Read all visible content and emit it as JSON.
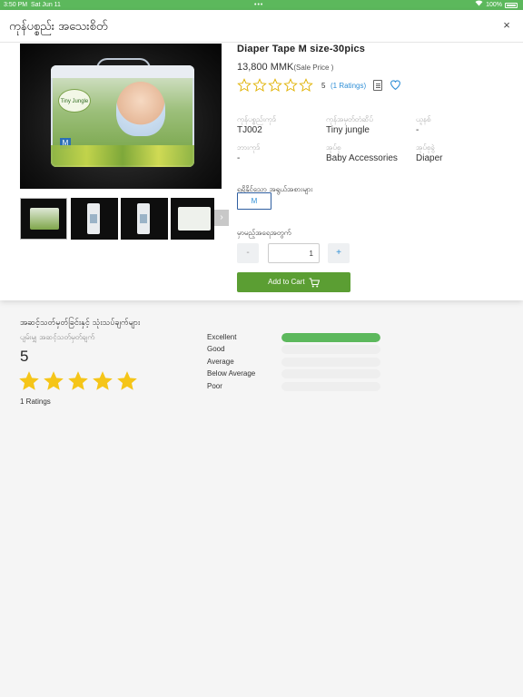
{
  "status_bar": {
    "time": "3:50 PM",
    "date": "Sat Jun 11",
    "battery": "100%"
  },
  "modal": {
    "title": "ကုန်ပစ္စည်း အသေးစိတ်",
    "close": "×"
  },
  "product": {
    "name": "Diaper Tape M size-30pics",
    "price": "13,800 MMK",
    "price_note": "(Sale Price )",
    "rating_value": "5",
    "rating_link": "(1 Ratings)",
    "thumbnail_next": "›"
  },
  "meta": [
    {
      "label": "ကုန်ပစ္စည်းကုဒ်",
      "value": "TJ002"
    },
    {
      "label": "ကုန်အမှတ်တံဆိပ်",
      "value": "Tiny jungle"
    },
    {
      "label": "ယူနစ်",
      "value": "-"
    },
    {
      "label": "ဘားကုဒ်",
      "value": "-"
    },
    {
      "label": "အုပ်စု",
      "value": "Baby Accessories"
    },
    {
      "label": "အုပ်စုခွဲ",
      "value": "Diaper"
    }
  ],
  "variants": {
    "label": "ရရှိနိုင်သော အရွယ်အစားများ",
    "options": [
      "M"
    ]
  },
  "quantity": {
    "label": "မှာမည့်အရေအတွက်",
    "minus": "-",
    "plus": "+",
    "value": "1"
  },
  "cart": {
    "label": "Add to Cart"
  },
  "reviews": {
    "title": "အဆင့်သတ်မှတ်ခြင်းနှင့် သုံးသပ်ချက်များ",
    "subtitle": "ပျမ်းမျှ အဆင့်သတ်မှတ်ချက်",
    "average": "5",
    "count": "1 Ratings",
    "breakdown": [
      {
        "label": "Excellent",
        "fraction": 1
      },
      {
        "label": "Good",
        "fraction": 0
      },
      {
        "label": "Average",
        "fraction": 0
      },
      {
        "label": "Below Average",
        "fraction": 0
      },
      {
        "label": "Poor",
        "fraction": 0
      }
    ]
  },
  "colors": {
    "brand_green": "#5cb85c",
    "cart_green": "#5b9e33",
    "link_blue": "#2f8fd6",
    "star_gold": "#f5c518"
  },
  "icons": [
    "close-icon",
    "star-outline-icon",
    "note-icon",
    "heart-icon",
    "cart-icon",
    "star-icon",
    "chevron-right-icon"
  ]
}
